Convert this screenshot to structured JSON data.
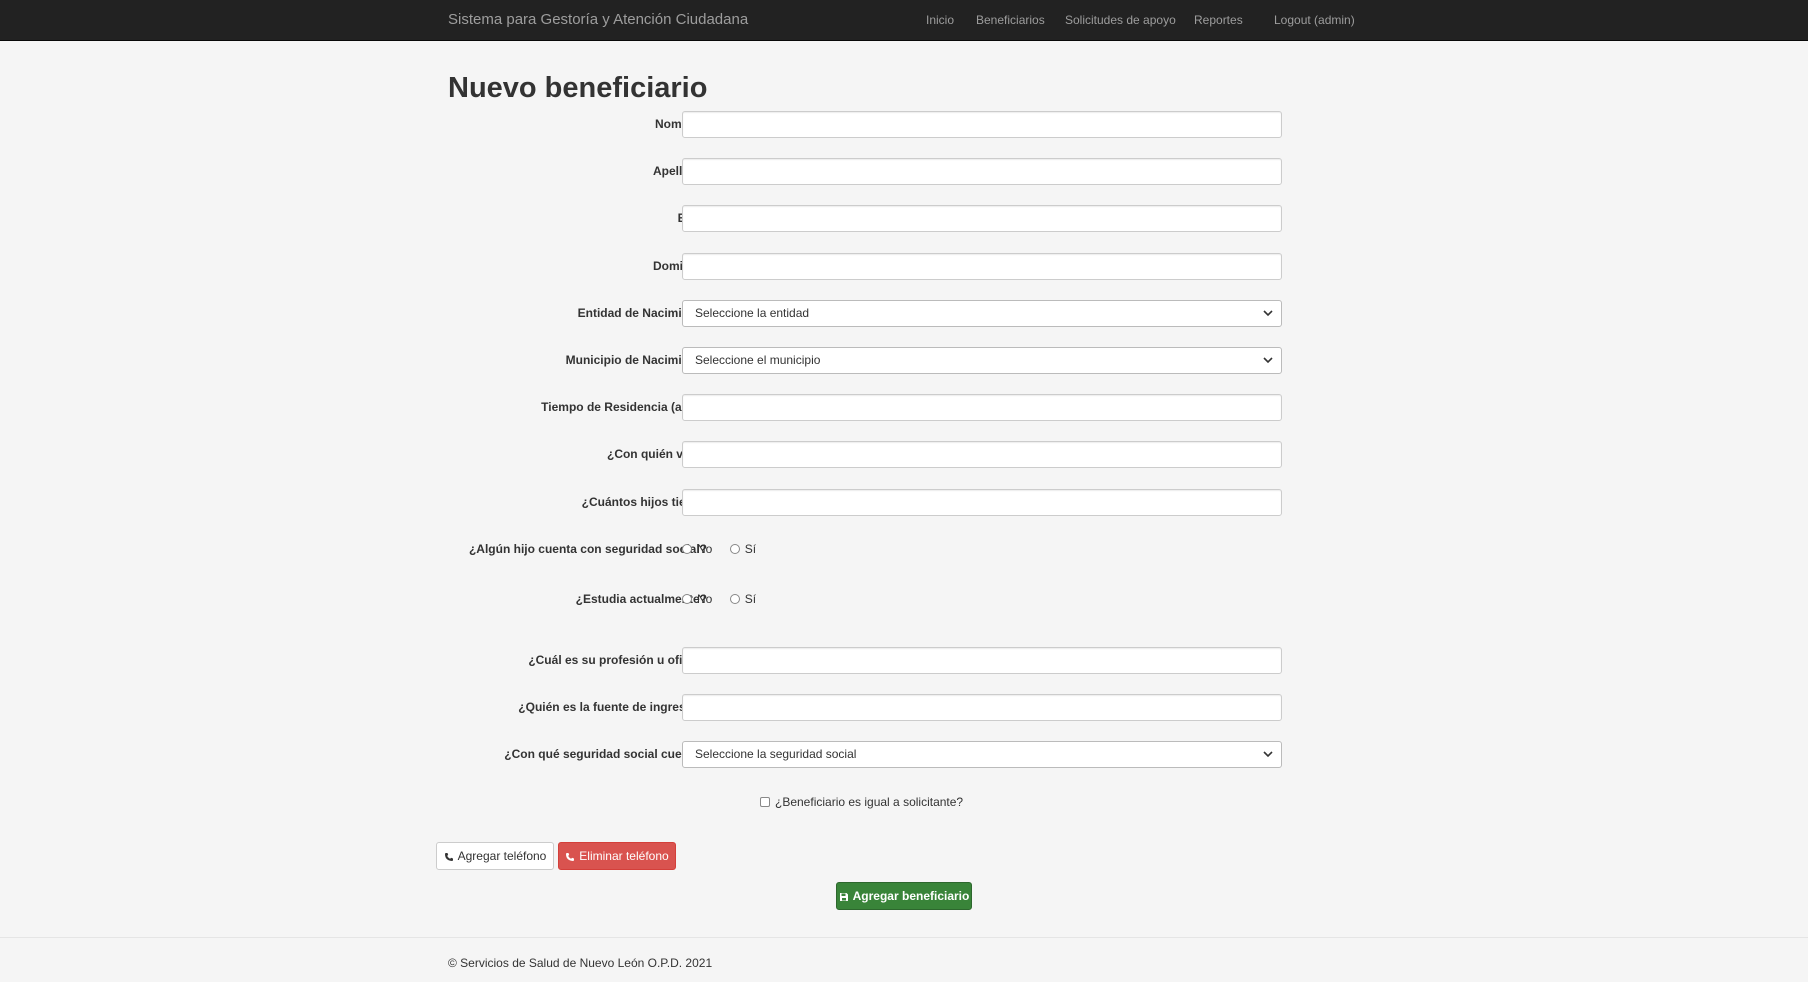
{
  "navbar": {
    "brand": "Sistema para Gestoría y Atención Ciudadana",
    "links": [
      "Inicio",
      "Beneficiarios",
      "Solicitudes de apoyo",
      "Reportes"
    ],
    "logout": "Logout (admin)"
  },
  "page": {
    "title": "Nuevo beneficiario"
  },
  "form": {
    "nombres": {
      "label": "Nombres",
      "value": ""
    },
    "apellidos": {
      "label": "Apellidos",
      "value": ""
    },
    "edad": {
      "label": "Edad",
      "value": ""
    },
    "domicilio": {
      "label": "Domicilio",
      "value": ""
    },
    "entidad": {
      "label": "Entidad de Nacimiento",
      "selected": "Seleccione la entidad"
    },
    "municipio": {
      "label": "Municipio de Nacimiento",
      "selected": "Seleccione el municipio"
    },
    "residencia": {
      "label": "Tiempo de Residencia (años)",
      "value": ""
    },
    "con_quien": {
      "label": "¿Con quién vive?",
      "value": ""
    },
    "hijos": {
      "label": "¿Cuántos hijos tiene?",
      "value": ""
    },
    "hijo_seguridad": {
      "label": "¿Algún hijo cuenta con seguridad social?",
      "options": [
        "No",
        "Sí"
      ]
    },
    "estudia": {
      "label": "¿Estudia actualmente?",
      "options": [
        "No",
        "Sí"
      ]
    },
    "profesion": {
      "label": "¿Cuál es su profesión u oficio?",
      "value": ""
    },
    "fuente_ingresos": {
      "label": "¿Quién es la fuente de ingresos?",
      "value": ""
    },
    "seguridad_social": {
      "label": "¿Con qué seguridad social cuenta?",
      "selected": "Seleccione la seguridad social"
    },
    "igual_solicitante": {
      "label": "¿Beneficiario es igual a solicitante?",
      "checked": false
    }
  },
  "buttons": {
    "add_phone": "Agregar teléfono",
    "remove_phone": "Eliminar teléfono",
    "submit": "Agregar beneficiario"
  },
  "footer": {
    "text": "© Servicios de Salud de Nuevo León O.P.D. 2021"
  },
  "icons": {
    "phone": "phone-icon",
    "save": "floppy-disk-icon",
    "chevron": "chevron-down-icon"
  },
  "colors": {
    "navbar": "#222222",
    "danger": "#d9534f",
    "success": "#398439"
  }
}
